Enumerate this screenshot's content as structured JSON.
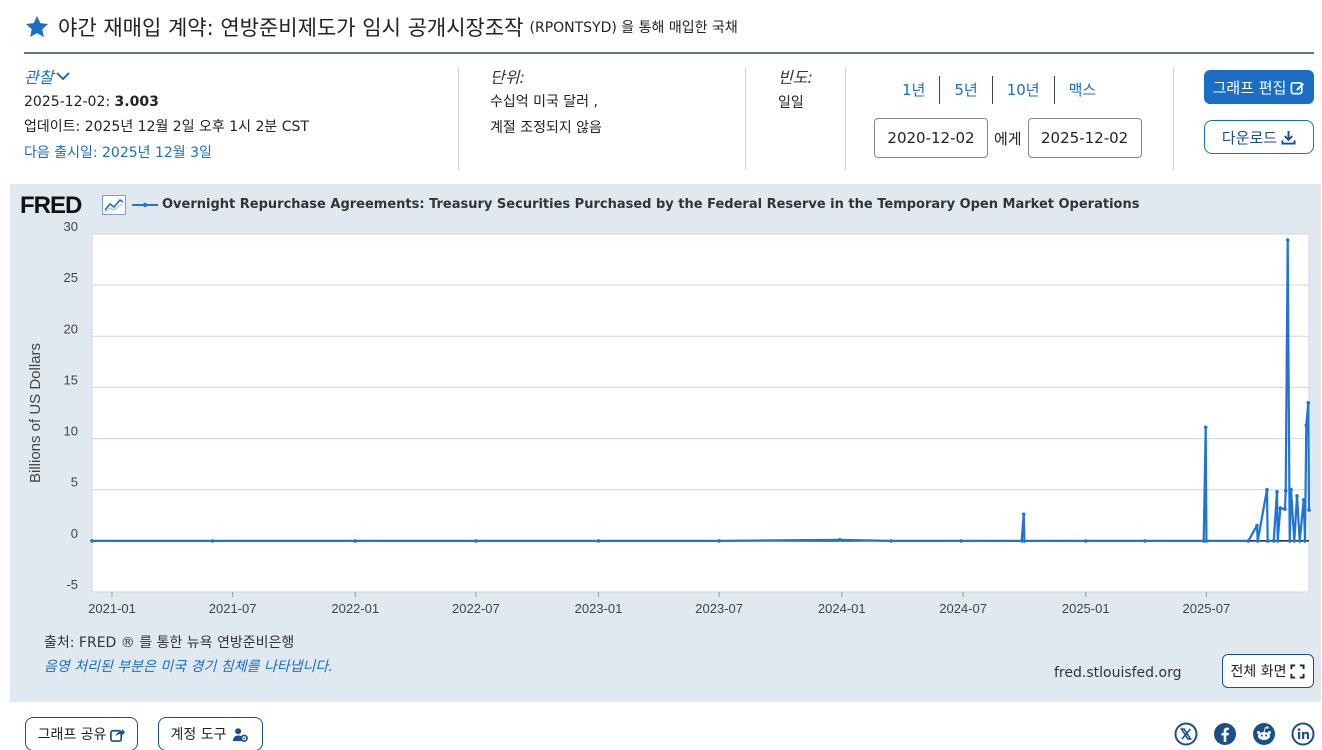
{
  "header": {
    "title": "야간 재매입 계약: 연방준비제도가 임시 공개시장조작",
    "series_suffix": "(RPONTSYD) 을 통해 매입한 국채"
  },
  "observation": {
    "label": "관찰",
    "date": "2025-12-02:",
    "value": "3.003",
    "updated": "업데이트: 2025년 12월 2일 오후 1시 2분 CST",
    "next_release": "다음 출시일: 2025년 12월 3일"
  },
  "units": {
    "label": "단위:",
    "line1": "수십억 미국 달러 ,",
    "line2": "계절 조정되지 않음"
  },
  "frequency": {
    "label": "빈도:",
    "value": "일일"
  },
  "range": {
    "links": [
      "1년",
      "5년",
      "10년",
      "맥스"
    ],
    "start": "2020-12-02",
    "to": "에게",
    "end": "2025-12-02"
  },
  "buttons": {
    "edit_graph": "그래프 편집",
    "download": "다운로드",
    "share": "그래프 공유",
    "account_tools": "계정 도구",
    "fullscreen": "전체 화면"
  },
  "graph": {
    "logo": "FRED",
    "source": "출처: FRED ® 를 통한 뉴욕 연방준비은행",
    "recession_note": "음영 처리된 부분은 미국 경기 침체를 나타냅니다.",
    "site": "fred.stlouisfed.org"
  },
  "colors": {
    "accent": "#1a6fc4",
    "series": "#1f74d6",
    "panel": "#e1e9f0"
  },
  "icons": [
    "star-icon",
    "chevron-down-icon",
    "edit-icon",
    "download-icon",
    "share-icon",
    "user-gear-icon",
    "fullscreen-icon",
    "x-icon",
    "facebook-icon",
    "reddit-icon",
    "linkedin-icon"
  ],
  "chart_data": {
    "type": "line",
    "title": "",
    "series": [
      {
        "name": "Overnight Repurchase Agreements: Treasury Securities Purchased by the Federal Reserve in the Temporary Open Market Operations",
        "x": [
          "2020-12-02",
          "2021-06-01",
          "2022-01-01",
          "2022-07-01",
          "2023-01-01",
          "2023-07-01",
          "2023-12-29",
          "2024-03-15",
          "2024-06-28",
          "2024-09-27",
          "2024-09-30",
          "2024-10-01",
          "2025-01-01",
          "2025-03-31",
          "2025-06-27",
          "2025-06-30",
          "2025-07-01",
          "2025-09-02",
          "2025-09-15",
          "2025-09-16",
          "2025-09-30",
          "2025-10-01",
          "2025-10-10",
          "2025-10-15",
          "2025-10-16",
          "2025-10-20",
          "2025-10-27",
          "2025-10-28",
          "2025-10-31",
          "2025-11-03",
          "2025-11-05",
          "2025-11-10",
          "2025-11-14",
          "2025-11-18",
          "2025-11-24",
          "2025-11-26",
          "2025-11-28",
          "2025-12-01",
          "2025-12-02"
        ],
        "y": [
          0,
          0,
          0,
          0,
          0,
          0,
          0.1,
          0,
          0,
          0,
          2.6,
          0,
          0,
          0,
          0,
          11.1,
          0,
          0,
          1.5,
          0,
          5.0,
          0,
          0,
          4.8,
          0,
          3.2,
          3.1,
          4.9,
          29.4,
          0,
          5.0,
          0,
          4.4,
          0,
          4.0,
          0,
          11.3,
          13.5,
          3.003
        ]
      }
    ],
    "x_ticks": [
      "2021-01",
      "2021-07",
      "2022-01",
      "2022-07",
      "2023-01",
      "2023-07",
      "2024-01",
      "2024-07",
      "2025-01",
      "2025-07"
    ],
    "y_ticks": [
      -5,
      0,
      5,
      10,
      15,
      20,
      25,
      30
    ],
    "ylabel": "Billions of US Dollars",
    "xlabel": "",
    "xlim": [
      "2020-12-02",
      "2025-12-02"
    ],
    "ylim": [
      -5,
      30
    ],
    "grid": true,
    "legend_position": "top-left"
  }
}
